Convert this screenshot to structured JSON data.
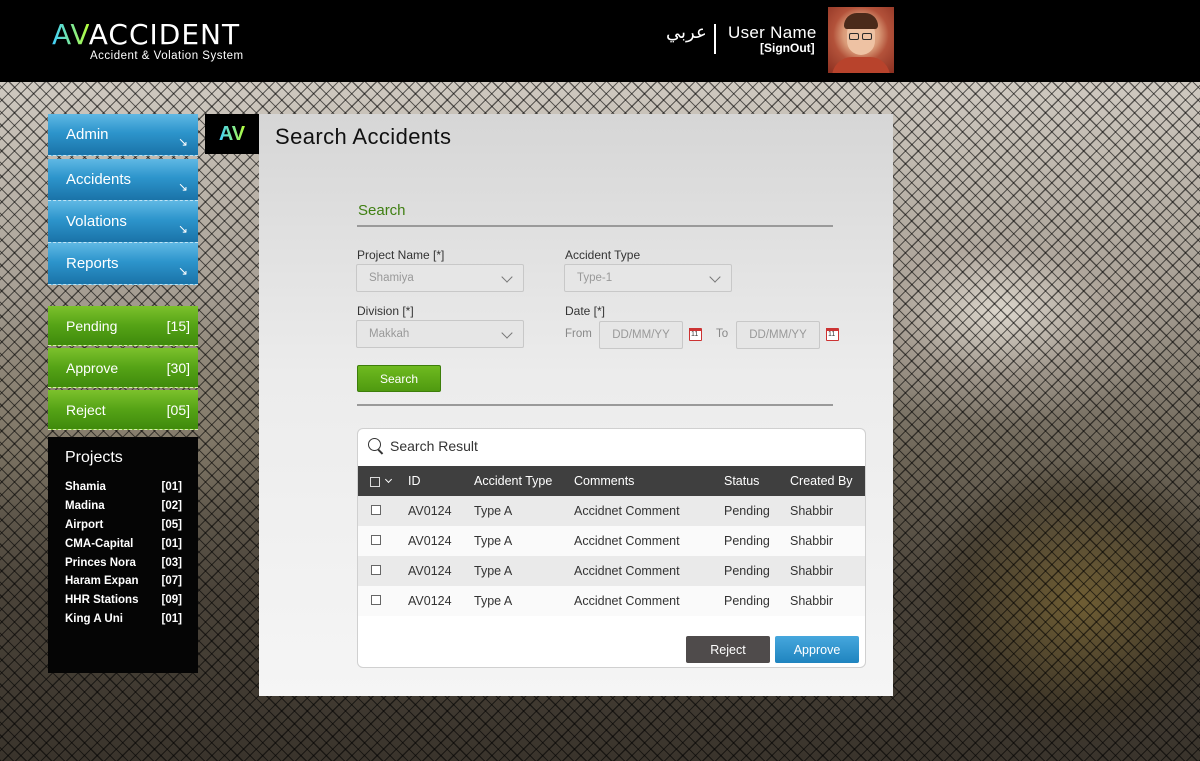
{
  "header": {
    "logo_accent": "AV",
    "logo_rest": "ACCIDENT",
    "logo_subtitle": "Accident & Volation System",
    "language_link": "عربي",
    "user_name": "User Name",
    "sign_out": "[SignOut]",
    "avatar_icon": "user-avatar-photo"
  },
  "sidebar": {
    "menu": [
      {
        "label": "Admin",
        "icon": "arrow-down-right-icon"
      },
      {
        "label": "Accidents",
        "icon": "arrow-down-right-icon"
      },
      {
        "label": "Volations",
        "icon": "arrow-down-right-icon"
      },
      {
        "label": "Reports",
        "icon": "arrow-down-right-icon"
      }
    ],
    "status": [
      {
        "label": "Pending",
        "count": "[15]"
      },
      {
        "label": "Approve",
        "count": "[30]"
      },
      {
        "label": "Reject",
        "count": "[05]"
      }
    ],
    "projects_title": "Projects",
    "projects": [
      {
        "name": "Shamia",
        "count": "[01]"
      },
      {
        "name": "Madina",
        "count": "[02]"
      },
      {
        "name": "Airport",
        "count": "[05]"
      },
      {
        "name": "CMA-Capital",
        "count": "[01]"
      },
      {
        "name": "Princes Nora",
        "count": "[03]"
      },
      {
        "name": "Haram Expan",
        "count": "[07]"
      },
      {
        "name": "HHR Stations",
        "count": "[09]"
      },
      {
        "name": "King A Uni",
        "count": "[01]"
      }
    ]
  },
  "main": {
    "badge": "AV",
    "title": "Search Accidents",
    "search_heading": "Search",
    "project_label": "Project Name [*]",
    "project_value": "Shamiya",
    "accident_type_label": "Accident Type",
    "accident_type_value": "Type-1",
    "division_label": "Division [*]",
    "division_value": "Makkah",
    "date_label": "Date [*]",
    "from_label": "From",
    "to_label": "To",
    "date_placeholder": "DD/MM/YY",
    "search_button": "Search",
    "result_heading": "Search Result",
    "columns": [
      "ID",
      "Accident Type",
      "Comments",
      "Status",
      "Created By"
    ],
    "rows": [
      {
        "id": "AV0124",
        "type": "Type A",
        "comment": "Accidnet Comment",
        "status": "Pending",
        "created_by": "Shabbir"
      },
      {
        "id": "AV0124",
        "type": "Type A",
        "comment": "Accidnet Comment",
        "status": "Pending",
        "created_by": "Shabbir"
      },
      {
        "id": "AV0124",
        "type": "Type A",
        "comment": "Accidnet Comment",
        "status": "Pending",
        "created_by": "Shabbir"
      },
      {
        "id": "AV0124",
        "type": "Type A",
        "comment": "Accidnet Comment",
        "status": "Pending",
        "created_by": "Shabbir"
      }
    ],
    "reject_button": "Reject",
    "approve_button": "Approve"
  },
  "colors": {
    "menu_blue": "#2d95cc",
    "status_green": "#55a316",
    "pending_red": "#e0281c",
    "search_green": "#3f7f12"
  }
}
